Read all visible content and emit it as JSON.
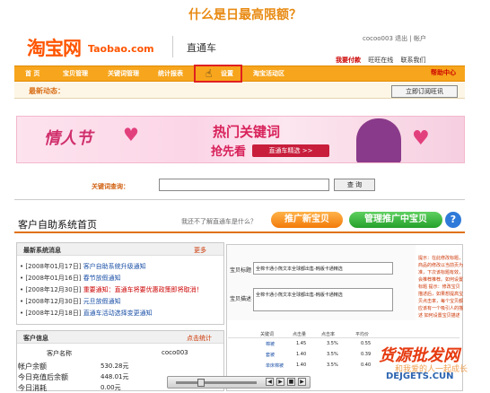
{
  "heading": "什么是日最高限额？",
  "header": {
    "logo_cn": "淘宝网",
    "logo_en": "Taobao.com",
    "product": "直通车",
    "account": "cocoo003 退出 | 帐户",
    "links": [
      "我要付款",
      "旺旺在线",
      "联系我们"
    ]
  },
  "nav": {
    "items": [
      "首 页",
      "宝贝管理",
      "关键词管理",
      "统计报表",
      "设置",
      "淘宝活动区"
    ],
    "help": "帮助中心"
  },
  "news": {
    "label": "最新动态：",
    "order_button": "立即订阅旺讯"
  },
  "banner": {
    "valentine": "情人节",
    "hot": "热门关键词",
    "rush": "抢先看",
    "button": "直通车精选 >>"
  },
  "keyword": {
    "label": "关键词查询：",
    "placeholder": "",
    "button": "查 询"
  },
  "home": {
    "title": "客户自助系统首页",
    "question": "我还不了解直通车是什么？",
    "promote_button": "推广新宝贝",
    "center_button": "管理推广中宝贝",
    "help_icon": "?"
  },
  "system_news": {
    "title": "最新系统消息",
    "more": "更多",
    "items": [
      {
        "date": "[2008年01月17日]",
        "text": "客户自助系统升级通知"
      },
      {
        "date": "[2008年01月16日]",
        "text": "春节放假通知"
      },
      {
        "date": "[2008年12月30日]",
        "text": "重要通知：直通车将要优惠政策即将取消！"
      },
      {
        "date": "[2008年12月30日]",
        "text": "元旦放假通知"
      },
      {
        "date": "[2008年12月18日]",
        "text": "直通车活动选择变更通知"
      }
    ]
  },
  "customer": {
    "title": "客户信息",
    "more": "点击统计",
    "name_label": "客户名称",
    "name_value": "coco003",
    "rows": [
      {
        "label": "帐户余额",
        "value": "530.28元"
      },
      {
        "label": "今日充值后余额",
        "value": "448.01元"
      },
      {
        "label": "今日消耗",
        "value": "0.00元"
      }
    ]
  },
  "item_panel": {
    "title_label": "宝贝标题",
    "title_value": "全棉卡通小熊文本全球都出售-韩版卡通精选",
    "desc_label": "宝贝描述",
    "desc_value": "全棉卡通小熊文本全球都出售-韩版卡通精选",
    "side_note": "提示：在此修改标题，商品的修改以当前页为准，下次该标题有效，会推荐推荐。如何设置标题 提示：修改宝贝描述后，如果想提高宝贝点击率，每个宝贝都应该有一个吸引人的描述 如何设置宝贝描述",
    "columns": [
      "关键词",
      "点击量",
      "点击率",
      "平均价"
    ],
    "rows": [
      {
        "keyword": "棉被",
        "clicks": "1.45",
        "rate": "3.5%",
        "price": "0.55"
      },
      {
        "keyword": "套被",
        "clicks": "1.40",
        "rate": "3.5%",
        "price": "0.39"
      },
      {
        "keyword": "单床棉被",
        "clicks": "1.40",
        "rate": "3.5%",
        "price": "0.40"
      }
    ]
  },
  "watermark": {
    "line1": "货源批发网",
    "line2": "和我爱的人一起成长",
    "line3": "DEJGETS.CUN"
  },
  "colors": {
    "accent_orange": "#f7a51c",
    "taobao_orange": "#ff5500",
    "highlight_red": "#e02020",
    "green_button": "#24a02a"
  }
}
